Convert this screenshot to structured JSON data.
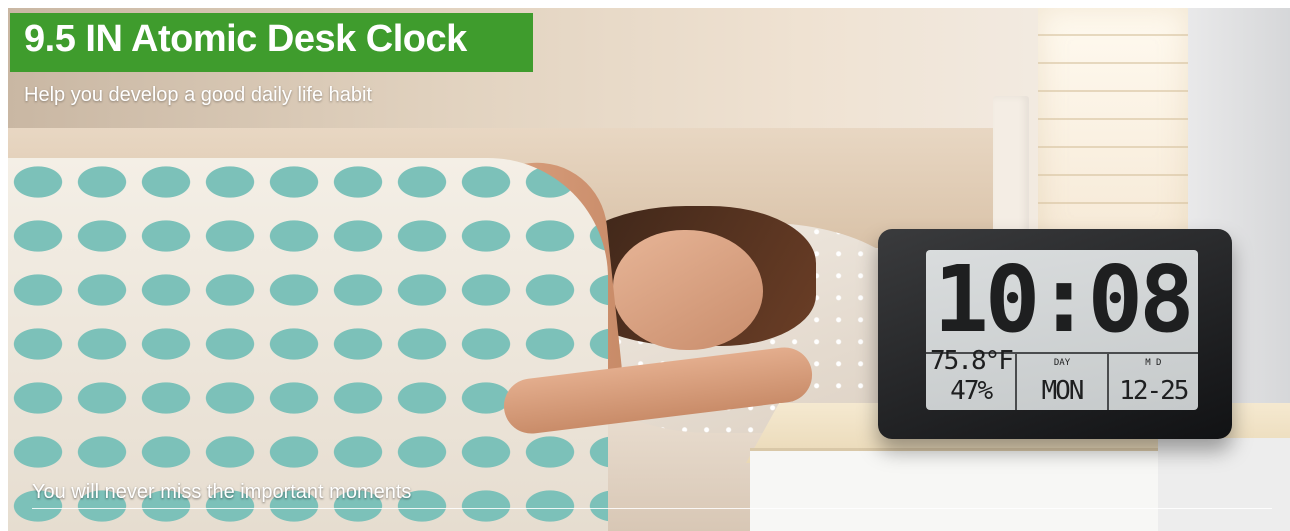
{
  "banner": {
    "title": "9.5 IN Atomic Desk Clock",
    "subtitle": "Help you develop a good daily life habit",
    "tagline": "You will never miss the important moments",
    "accent_color": "#3f9c2d"
  },
  "clock_display": {
    "time": "10:08",
    "temperature": "75.8°F",
    "humidity": "47%",
    "day_label": "DAY",
    "day": "MON",
    "date_label": "M D",
    "date": "12-25"
  }
}
